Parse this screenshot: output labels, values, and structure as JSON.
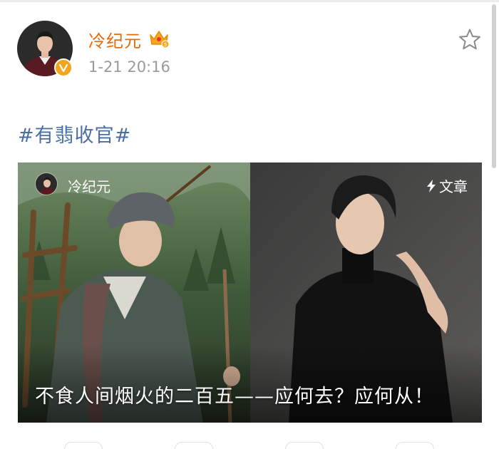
{
  "post": {
    "username": "冷纪元",
    "timestamp": "1-21 20:16",
    "hashtag": "#有翡收官#"
  },
  "card": {
    "author": "冷纪元",
    "type_label": "文章",
    "title": "不食人间烟火的二百五——应何去？应何从！"
  },
  "icons": {
    "verify": "verified-badge-icon",
    "crown": "crown-level-icon",
    "favorite": "star-icon",
    "article": "lightning-icon"
  },
  "colors": {
    "username": "#e86b0a",
    "hashtag": "#4a6fa3",
    "timestamp": "#9a9a9a",
    "badge": "#f3a51c"
  }
}
